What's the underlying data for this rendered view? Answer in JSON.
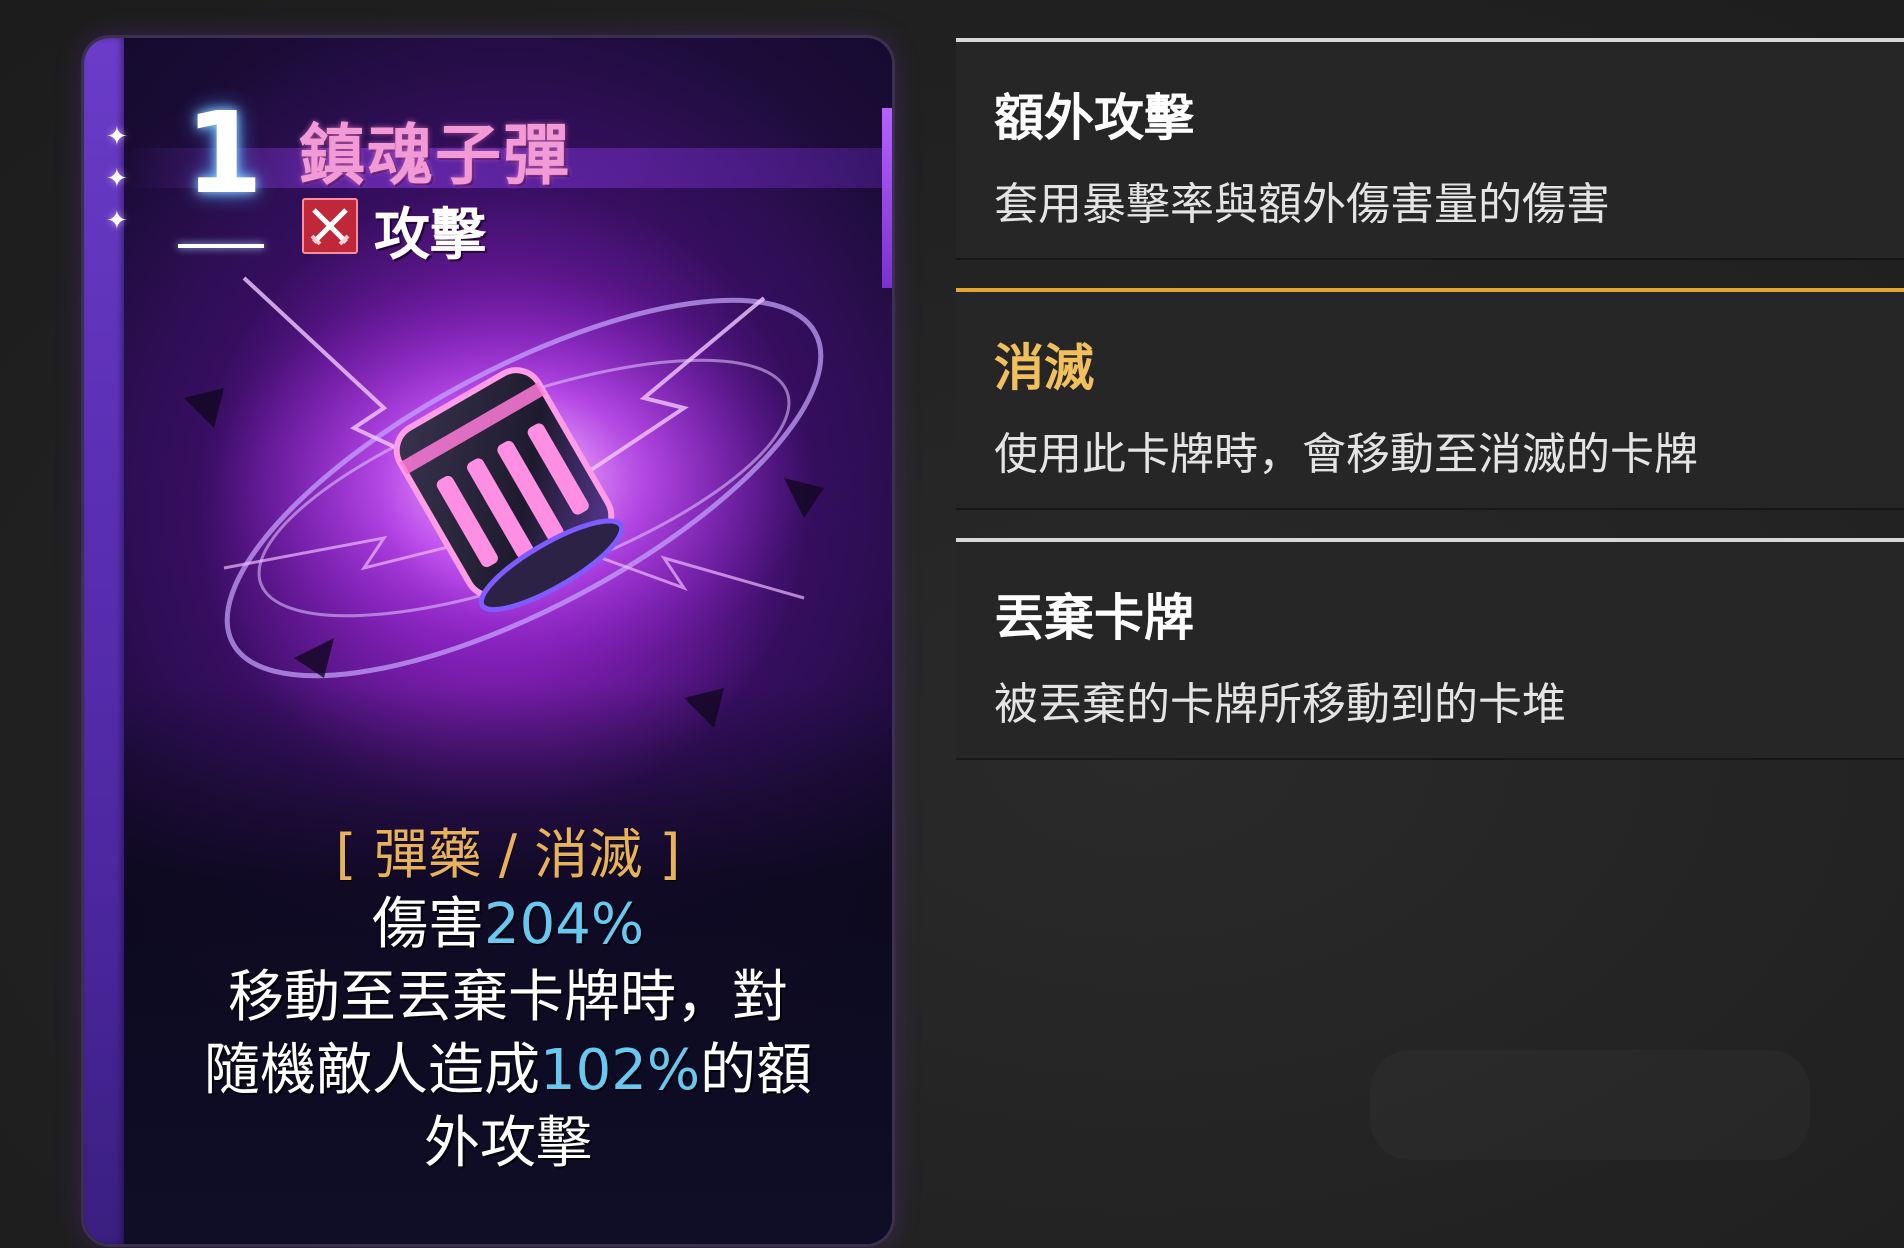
{
  "card": {
    "cost": "1",
    "name": "鎮魂子彈",
    "type_icon": "crossed-swords-icon",
    "type_label": "攻擊",
    "keywords": "[ 彈藥 / 消滅 ]",
    "desc": {
      "line1_pre": "傷害",
      "line1_val": "204%",
      "line2": "移動至丟棄卡牌時，對",
      "line3_pre": "隨機敵人造成",
      "line3_val": "102%",
      "line3_post": "的額",
      "line4": "外攻擊"
    },
    "colors": {
      "name": "#f29ad6",
      "keyword": "#e8b25a",
      "value_highlight": "#69c8f0",
      "frame": "#6a3cc8"
    }
  },
  "tooltips": [
    {
      "title": "額外攻擊",
      "desc": "套用暴擊率與額外傷害量的傷害",
      "accent": "#d8d8d8"
    },
    {
      "title": "消滅",
      "desc": "使用此卡牌時，會移動至消滅的卡牌",
      "accent": "#e2a733"
    },
    {
      "title": "丟棄卡牌",
      "desc": "被丟棄的卡牌所移動到的卡堆",
      "accent": "#d8d8d8"
    }
  ]
}
